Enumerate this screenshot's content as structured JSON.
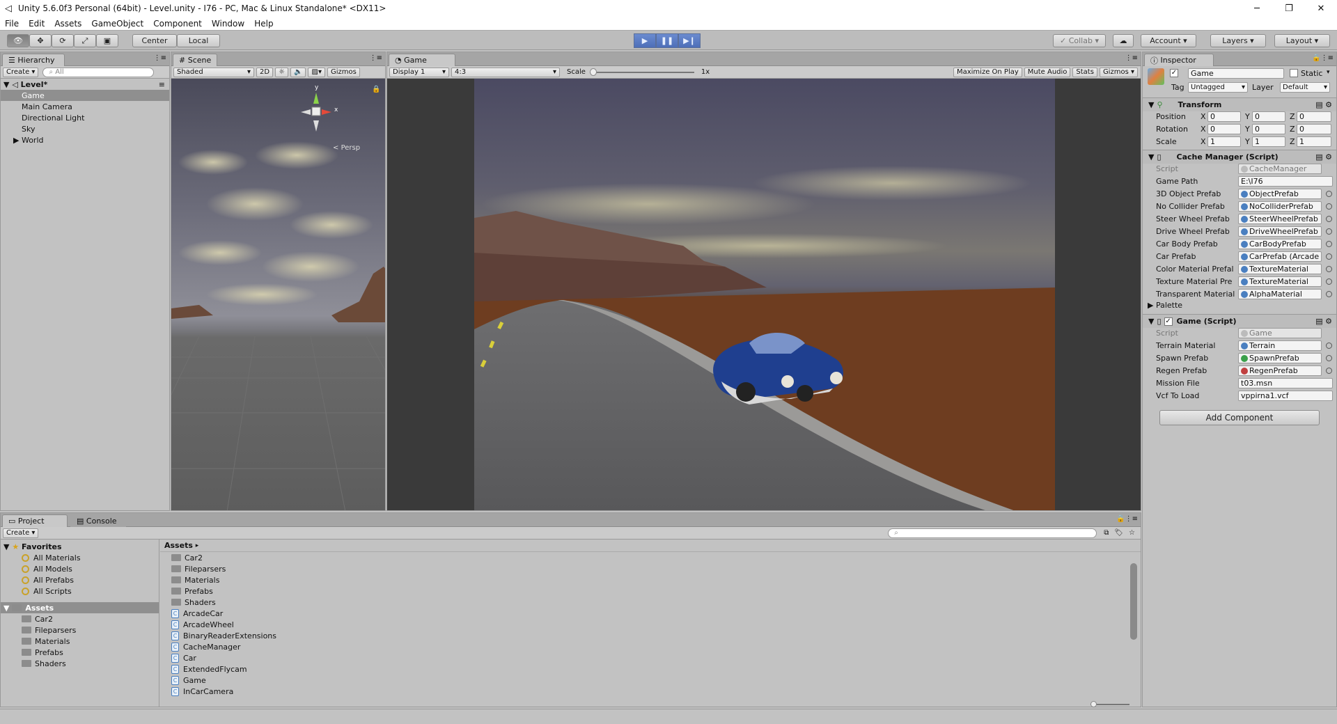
{
  "window": {
    "title": "Unity 5.6.0f3 Personal (64bit) - Level.unity - I76 - PC, Mac & Linux Standalone* <DX11>"
  },
  "menu": [
    "File",
    "Edit",
    "Assets",
    "GameObject",
    "Component",
    "Window",
    "Help"
  ],
  "toolbar": {
    "pivot": "Center",
    "space": "Local",
    "collab": "Collab",
    "account": "Account",
    "layers": "Layers",
    "layout": "Layout"
  },
  "hierarchy": {
    "tab": "Hierarchy",
    "create": "Create",
    "search_placeholder": "All",
    "scene": "Level*",
    "items": [
      "Game",
      "Main Camera",
      "Directional Light",
      "Sky",
      "World"
    ]
  },
  "scene": {
    "tab": "Scene",
    "shading": "Shaded",
    "mode2d": "2D",
    "gizmos": "Gizmos",
    "persp": "Persp",
    "gizmo_y": "y",
    "gizmo_x": "x"
  },
  "game": {
    "tab": "Game",
    "display": "Display 1",
    "aspect": "4:3",
    "scale_label": "Scale",
    "scale_value": "1x",
    "maximize": "Maximize On Play",
    "mute": "Mute Audio",
    "stats": "Stats",
    "gizmos": "Gizmos"
  },
  "inspector": {
    "tab": "Inspector",
    "name": "Game",
    "static": "Static",
    "tag_label": "Tag",
    "tag": "Untagged",
    "layer_label": "Layer",
    "layer": "Default",
    "transform": {
      "title": "Transform",
      "rows": [
        {
          "label": "Position",
          "x": "0",
          "y": "0",
          "z": "0"
        },
        {
          "label": "Rotation",
          "x": "0",
          "y": "0",
          "z": "0"
        },
        {
          "label": "Scale",
          "x": "1",
          "y": "1",
          "z": "1"
        }
      ],
      "axis_x": "X",
      "axis_y": "Y",
      "axis_z": "Z"
    },
    "cache_manager": {
      "title": "Cache Manager (Script)",
      "script_label": "Script",
      "script": "CacheManager",
      "game_path_label": "Game Path",
      "game_path": "E:\\I76",
      "fields": [
        {
          "label": "3D Object Prefab",
          "value": "ObjectPrefab"
        },
        {
          "label": "No Collider Prefab",
          "value": "NoColliderPrefab"
        },
        {
          "label": "Steer Wheel Prefab",
          "value": "SteerWheelPrefab"
        },
        {
          "label": "Drive Wheel Prefab",
          "value": "DriveWheelPrefab"
        },
        {
          "label": "Car Body Prefab",
          "value": "CarBodyPrefab"
        },
        {
          "label": "Car Prefab",
          "value": "CarPrefab (Arcade"
        },
        {
          "label": "Color Material Prefal",
          "value": "TextureMaterial"
        },
        {
          "label": "Texture Material Pre",
          "value": "TextureMaterial"
        },
        {
          "label": "Transparent Material",
          "value": "AlphaMaterial"
        }
      ],
      "palette": "Palette"
    },
    "game_script": {
      "title": "Game (Script)",
      "script_label": "Script",
      "script": "Game",
      "fields": [
        {
          "label": "Terrain Material",
          "value": "Terrain"
        },
        {
          "label": "Spawn Prefab",
          "value": "SpawnPrefab"
        },
        {
          "label": "Regen Prefab",
          "value": "RegenPrefab"
        }
      ],
      "mission_label": "Mission File",
      "mission": "t03.msn",
      "vcf_label": "Vcf To Load",
      "vcf": "vppirna1.vcf"
    },
    "add_component": "Add Component"
  },
  "project": {
    "tab_project": "Project",
    "tab_console": "Console",
    "create": "Create",
    "favorites_label": "Favorites",
    "favorites": [
      "All Materials",
      "All Models",
      "All Prefabs",
      "All Scripts"
    ],
    "assets_label": "Assets",
    "asset_folders": [
      "Car2",
      "Fileparsers",
      "Materials",
      "Prefabs",
      "Shaders"
    ],
    "breadcrumb": "Assets",
    "contents": [
      {
        "name": "Car2",
        "kind": "folder"
      },
      {
        "name": "Fileparsers",
        "kind": "folder"
      },
      {
        "name": "Materials",
        "kind": "folder"
      },
      {
        "name": "Prefabs",
        "kind": "folder"
      },
      {
        "name": "Shaders",
        "kind": "folder"
      },
      {
        "name": "ArcadeCar",
        "kind": "script"
      },
      {
        "name": "ArcadeWheel",
        "kind": "script"
      },
      {
        "name": "BinaryReaderExtensions",
        "kind": "script"
      },
      {
        "name": "CacheManager",
        "kind": "script"
      },
      {
        "name": "Car",
        "kind": "script"
      },
      {
        "name": "ExtendedFlycam",
        "kind": "script"
      },
      {
        "name": "Game",
        "kind": "script"
      },
      {
        "name": "InCarCamera",
        "kind": "script"
      }
    ]
  }
}
